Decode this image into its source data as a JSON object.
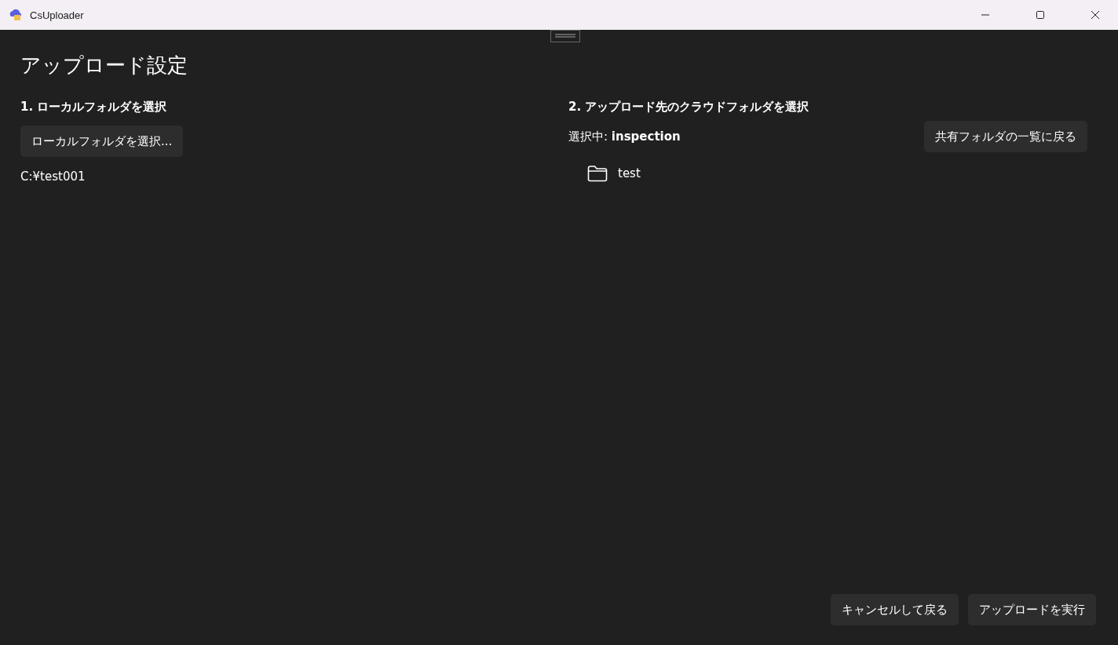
{
  "window": {
    "title": "CsUploader"
  },
  "page": {
    "title": "アップロード設定"
  },
  "local": {
    "heading": "1. ローカルフォルダを選択",
    "button": "ローカルフォルダを選択...",
    "path": "C:¥test001"
  },
  "cloud": {
    "heading": "2. アップロード先のクラウドフォルダを選択",
    "current": "選択中: **inspection**",
    "back_button": "共有フォルダの一覧に戻る",
    "folders": [
      {
        "name": "test"
      }
    ]
  },
  "buttons": [
    "キャンセルして戻る",
    "アップロードを実行"
  ]
}
